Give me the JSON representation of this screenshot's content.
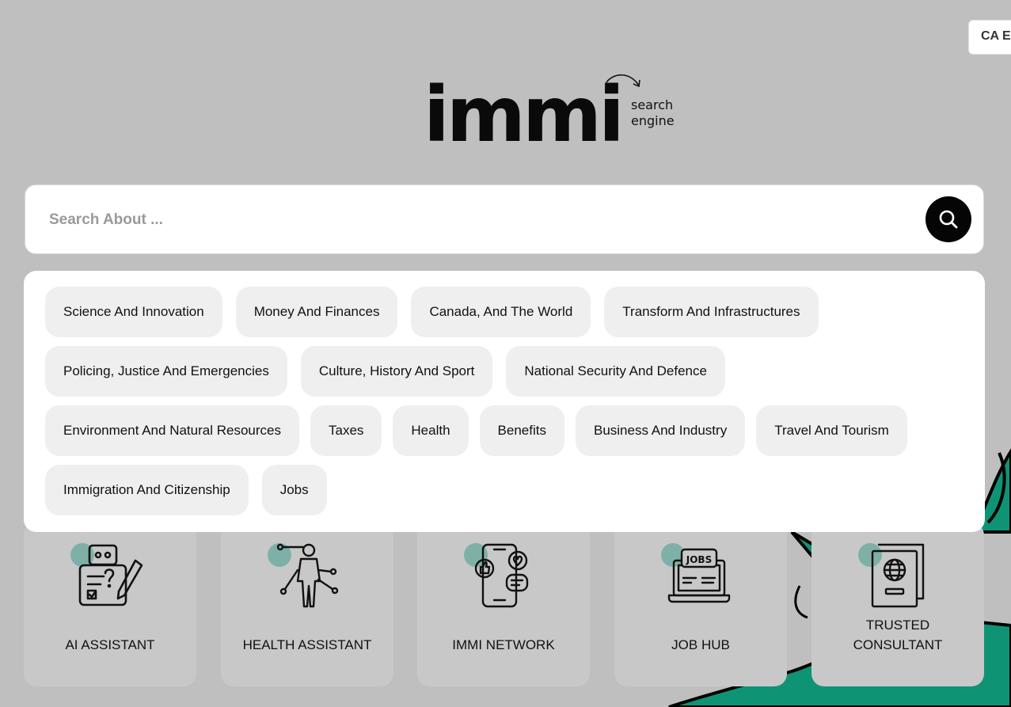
{
  "header": {
    "language_label": "CA En"
  },
  "logo": {
    "word": "immi",
    "sub_line1": "search",
    "sub_line2": "engine"
  },
  "search": {
    "placeholder": "Search About ...",
    "value": ""
  },
  "categories": [
    "Science And Innovation",
    "Money And Finances",
    "Canada, And The World",
    "Transform And Infrastructures",
    "Policing, Justice And Emergencies",
    "Culture, History And Sport",
    "National Security And Defence",
    "Environment And Natural Resources",
    "Taxes",
    "Health",
    "Benefits",
    "Business And Industry",
    "Travel And Tourism",
    "Immigration And Citizenship",
    "Jobs"
  ],
  "services": [
    {
      "label": "AI ASSISTANT",
      "icon": "ai-assistant-icon"
    },
    {
      "label": "HEALTH ASSISTANT",
      "icon": "health-assistant-icon"
    },
    {
      "label": "IMMI NETWORK",
      "icon": "network-icon"
    },
    {
      "label": "JOB HUB",
      "icon": "jobs-icon"
    },
    {
      "label_line1": "TRUSTED",
      "label_line2": "CONSULTANT",
      "icon": "passport-icon"
    }
  ],
  "colors": {
    "background": "#bfbfbf",
    "card": "#c8c8c8",
    "chip": "#efefef",
    "accent_dot": "#7fb0a8",
    "decor_green": "#0e9475",
    "search_button": "#050505"
  }
}
